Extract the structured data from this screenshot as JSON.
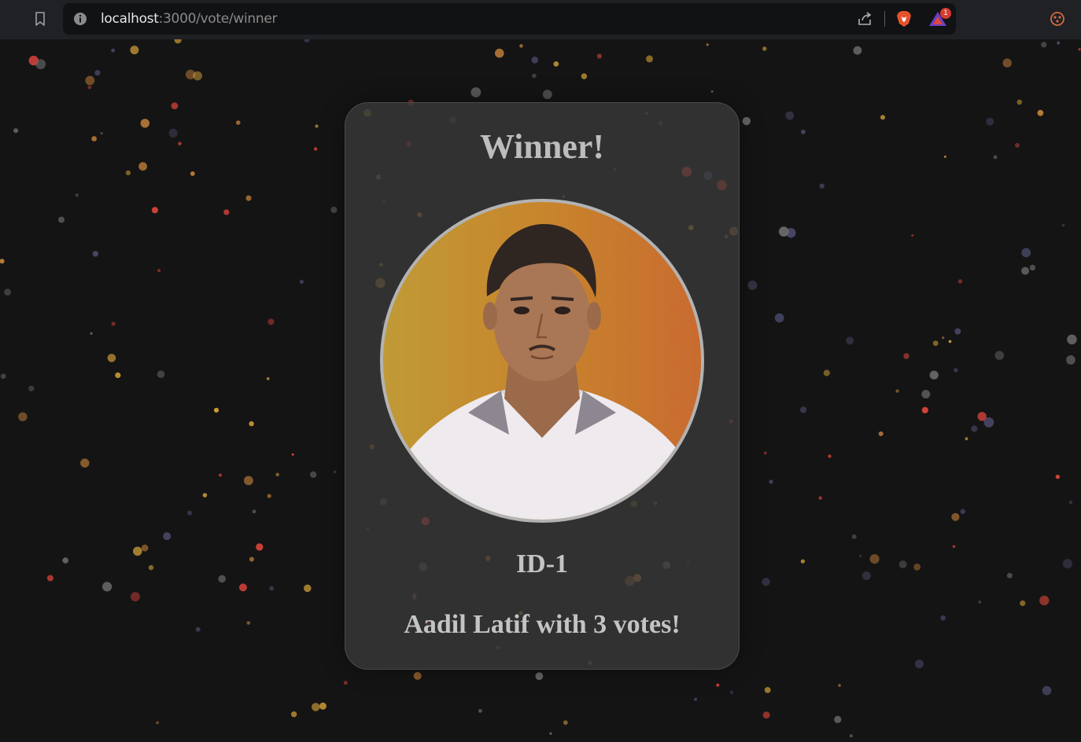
{
  "browser": {
    "url_host": "localhost",
    "url_path": ":3000/vote/winner",
    "notification_count": "1"
  },
  "winner": {
    "title": "Winner!",
    "candidate_id": "ID-1",
    "result_text": "Aadil Latif with 3 votes!"
  },
  "colors": {
    "background": "#141414",
    "card": "#3a3a3a",
    "confetti": [
      "#d9a63a",
      "#e0463c",
      "#6a6a6a",
      "#4a4a6a",
      "#c2803a"
    ]
  }
}
